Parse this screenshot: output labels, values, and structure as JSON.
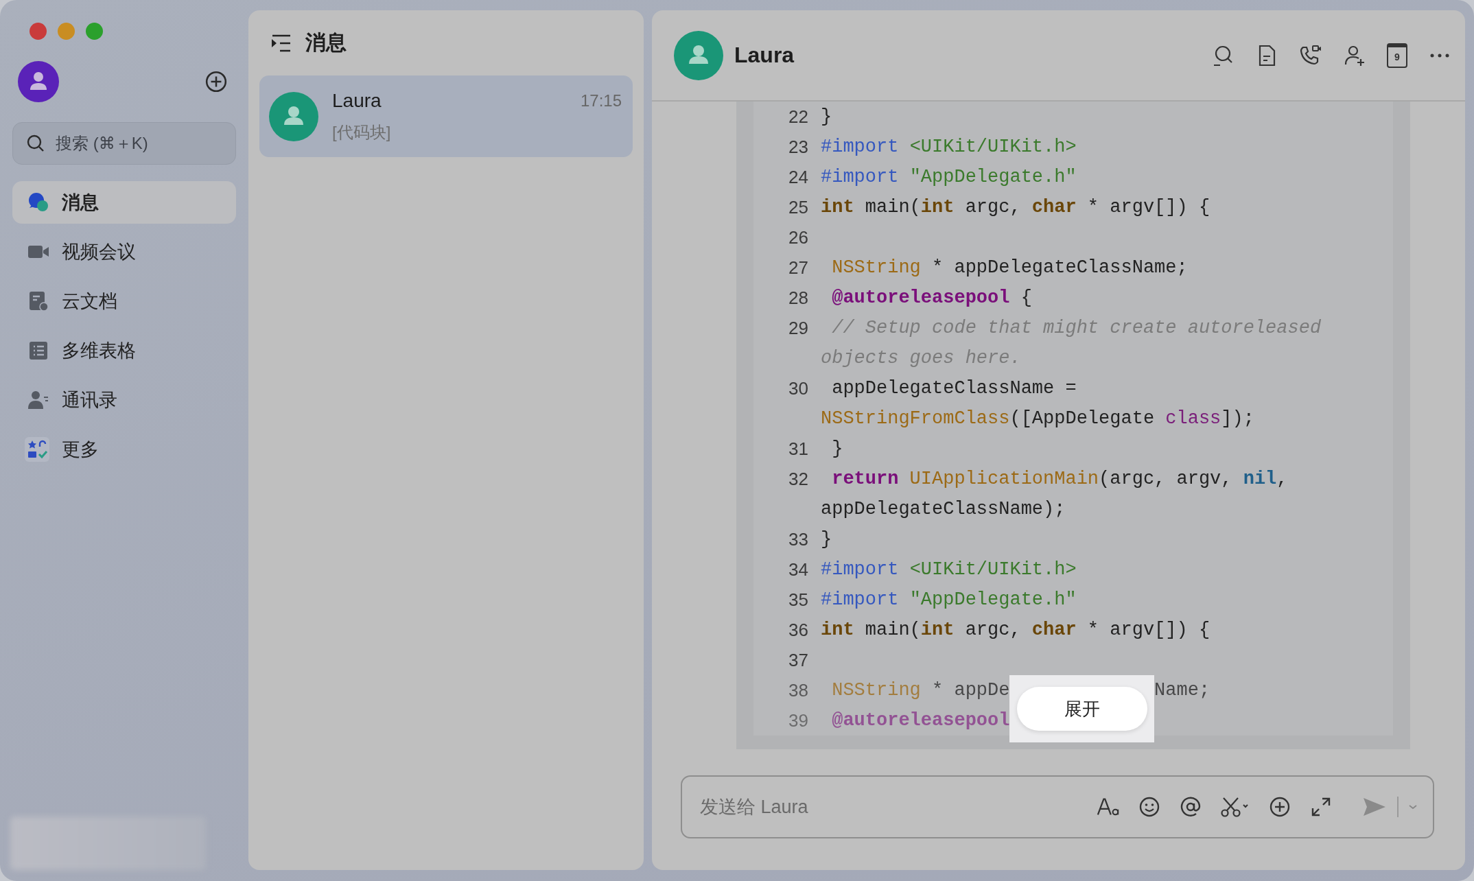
{
  "window": {
    "controls": [
      {
        "color": "#c93b3b"
      },
      {
        "color": "#c98d22"
      },
      {
        "color": "#2ba02c"
      }
    ]
  },
  "sidebar": {
    "search": {
      "placeholder": "搜索 (⌘＋K)"
    },
    "items": [
      {
        "kind": "chat",
        "label": "消息",
        "selected": true
      },
      {
        "kind": "video",
        "label": "视频会议",
        "selected": false
      },
      {
        "kind": "docs",
        "label": "云文档",
        "selected": false
      },
      {
        "kind": "table",
        "label": "多维表格",
        "selected": false
      },
      {
        "kind": "contacts",
        "label": "通讯录",
        "selected": false
      },
      {
        "kind": "more",
        "label": "更多",
        "selected": false
      }
    ]
  },
  "conversation_list": {
    "title": "消息",
    "items": [
      {
        "name": "Laura",
        "time": "17:15",
        "preview": "[代码块]",
        "selected": true
      }
    ]
  },
  "chat": {
    "title": "Laura",
    "calendar_day": "9",
    "code_block": {
      "expand_button": "展开",
      "lines": [
        {
          "number": "22",
          "tokens": [
            {
              "kind": "plain",
              "text": "}"
            }
          ]
        },
        {
          "number": "23",
          "tokens": [
            {
              "kind": "directive",
              "text": "#import "
            },
            {
              "kind": "string",
              "text": "<UIKit/UIKit.h>"
            }
          ]
        },
        {
          "number": "24",
          "tokens": [
            {
              "kind": "directive",
              "text": "#import "
            },
            {
              "kind": "string",
              "text": "\"AppDelegate.h\""
            }
          ]
        },
        {
          "number": "25",
          "tokens": [
            {
              "kind": "keyword",
              "text": "int"
            },
            {
              "kind": "plain",
              "text": " main("
            },
            {
              "kind": "keyword",
              "text": "int"
            },
            {
              "kind": "plain",
              "text": " argc, "
            },
            {
              "kind": "keyword",
              "text": "char"
            },
            {
              "kind": "plain",
              "text": " * argv[]) {"
            }
          ]
        },
        {
          "number": "26"
        },
        {
          "number": "27",
          "tokens": [
            {
              "kind": "type",
              "text": " NSString"
            },
            {
              "kind": "plain",
              "text": " * appDelegateClassName;"
            }
          ]
        },
        {
          "number": "28",
          "tokens": [
            {
              "kind": "attribute",
              "text": " @autoreleasepool"
            },
            {
              "kind": "plain",
              "text": " {"
            }
          ]
        },
        {
          "number": "29",
          "tokens": [
            {
              "kind": "comment",
              "text": " // Setup code that might create autoreleased"
            },
            {
              "kind": "break"
            },
            {
              "kind": "comment",
              "text": "objects goes here."
            }
          ]
        },
        {
          "number": "30",
          "tokens": [
            {
              "kind": "plain",
              "text": " appDelegateClassName ="
            },
            {
              "kind": "break"
            },
            {
              "kind": "function",
              "text": "NSStringFromClass"
            },
            {
              "kind": "plain",
              "text": "([AppDelegate "
            },
            {
              "kind": "class_kw",
              "text": "class"
            },
            {
              "kind": "plain",
              "text": "]);"
            }
          ]
        },
        {
          "number": "31",
          "tokens": [
            {
              "kind": "plain",
              "text": " }"
            }
          ]
        },
        {
          "number": "32",
          "tokens": [
            {
              "kind": "attribute",
              "text": " return"
            },
            {
              "kind": "function",
              "text": " UIApplicationMain"
            },
            {
              "kind": "plain",
              "text": "(argc, argv, "
            },
            {
              "kind": "literal",
              "text": "nil"
            },
            {
              "kind": "plain",
              "text": ","
            },
            {
              "kind": "break"
            },
            {
              "kind": "plain",
              "text": "appDelegateClassName);"
            }
          ]
        },
        {
          "number": "33",
          "tokens": [
            {
              "kind": "plain",
              "text": "}"
            }
          ]
        },
        {
          "number": "34",
          "tokens": [
            {
              "kind": "directive",
              "text": "#import "
            },
            {
              "kind": "string",
              "text": "<UIKit/UIKit.h>"
            }
          ]
        },
        {
          "number": "35",
          "tokens": [
            {
              "kind": "directive",
              "text": "#import "
            },
            {
              "kind": "string",
              "text": "\"AppDelegate.h\""
            }
          ]
        },
        {
          "number": "36",
          "tokens": [
            {
              "kind": "keyword",
              "text": "int"
            },
            {
              "kind": "plain",
              "text": " main("
            },
            {
              "kind": "keyword",
              "text": "int"
            },
            {
              "kind": "plain",
              "text": " argc, "
            },
            {
              "kind": "keyword",
              "text": "char"
            },
            {
              "kind": "plain",
              "text": " * argv[]) {"
            }
          ]
        },
        {
          "number": "37"
        },
        {
          "number": "38",
          "tokens": [
            {
              "kind": "type",
              "text": " NSString"
            },
            {
              "kind": "plain",
              "text": " * appDe"
            },
            {
              "kind": "after_cover",
              "text": "Name;"
            }
          ]
        },
        {
          "number": "39",
          "tokens": [
            {
              "kind": "attribute",
              "text": " @autoreleasepool"
            }
          ]
        }
      ]
    },
    "composer": {
      "placeholder": "发送给 Laura"
    }
  }
}
